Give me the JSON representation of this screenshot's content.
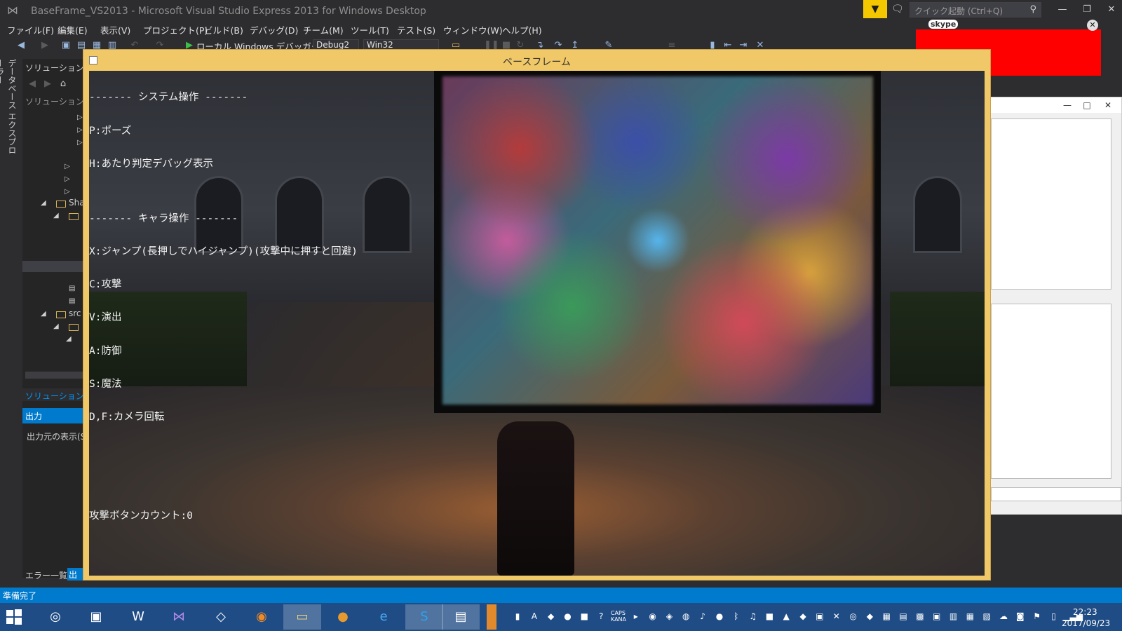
{
  "titlebar": {
    "title": "BaseFrame_VS2013 - Microsoft Visual Studio Express 2013 for Windows Desktop",
    "quick_launch_placeholder": "クイック起動 (Ctrl+Q)"
  },
  "menu": [
    "ファイル(F)",
    "編集(E)",
    "表示(V)",
    "プロジェクト(P)",
    "ビルド(B)",
    "デバッグ(D)",
    "チーム(M)",
    "ツール(T)",
    "テスト(S)",
    "ウィンドウ(W)",
    "ヘルプ(H)"
  ],
  "toolbar": {
    "debugger_label": "ローカル Windows デバッガー",
    "configuration": "Debug2",
    "platform": "Win32"
  },
  "side_tab": "データベース エクスプローラー",
  "solution_explorer": {
    "title": "ソリューション エク",
    "title2": "ソリューション エク",
    "tree_labels": [
      "Sha",
      "src"
    ],
    "bottom_tab": "ソリューション エ",
    "output_header": "出力",
    "output_source_label": "出力元の表示(S",
    "error_tab": "エラー一覧",
    "output_tab": "出力"
  },
  "skype_label": "skype",
  "game_window": {
    "title": "ベースフレーム",
    "overlay_lines": [
      "------- システム操作 -------",
      "P:ポーズ",
      "H:あたり判定デバッグ表示",
      "",
      "------- キャラ操作 -------",
      "X:ジャンプ(長押しでハイジャンプ)(攻撃中に押すと回避)",
      "C:攻撃",
      "V:演出",
      "A:防御",
      "S:魔法",
      "D,F:カメラ回転",
      "",
      "",
      "",
      "攻撃ボタンカウント:0"
    ]
  },
  "status": "準備完了",
  "taskbar": {
    "tray_labels": [
      "CAPS",
      "KANA"
    ],
    "time": "22:23",
    "date": "2017/09/23"
  }
}
